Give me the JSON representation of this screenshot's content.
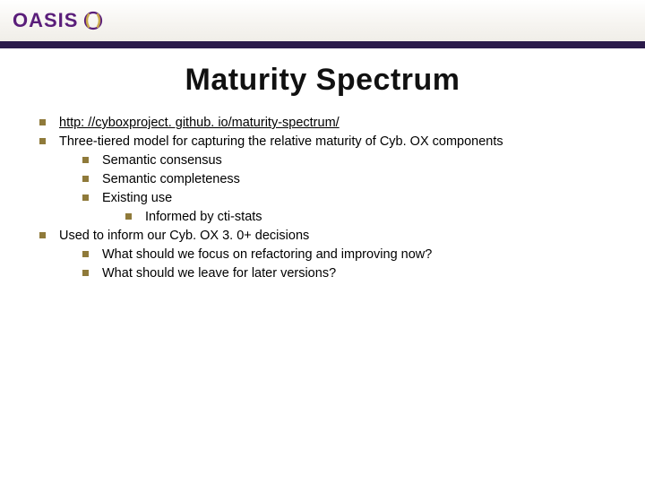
{
  "logo": {
    "text": "OASIS"
  },
  "title": "Maturity Spectrum",
  "bullets": {
    "b0": "http: //cyboxproject. github. io/maturity-spectrum/",
    "b1": "Three-tiered model for capturing the relative maturity of Cyb. OX components",
    "b1_0": "Semantic consensus",
    "b1_1": "Semantic completeness",
    "b1_2": "Existing use",
    "b1_2_0": "Informed by cti-stats",
    "b2": "Used to inform our Cyb. OX 3. 0+ decisions",
    "b2_0": "What should we focus on refactoring and improving now?",
    "b2_1": "What should we leave for later versions?"
  },
  "colors": {
    "accent": "#2b1a4a",
    "bullet": "#8f7a3a",
    "logo": "#5a1e7a"
  }
}
